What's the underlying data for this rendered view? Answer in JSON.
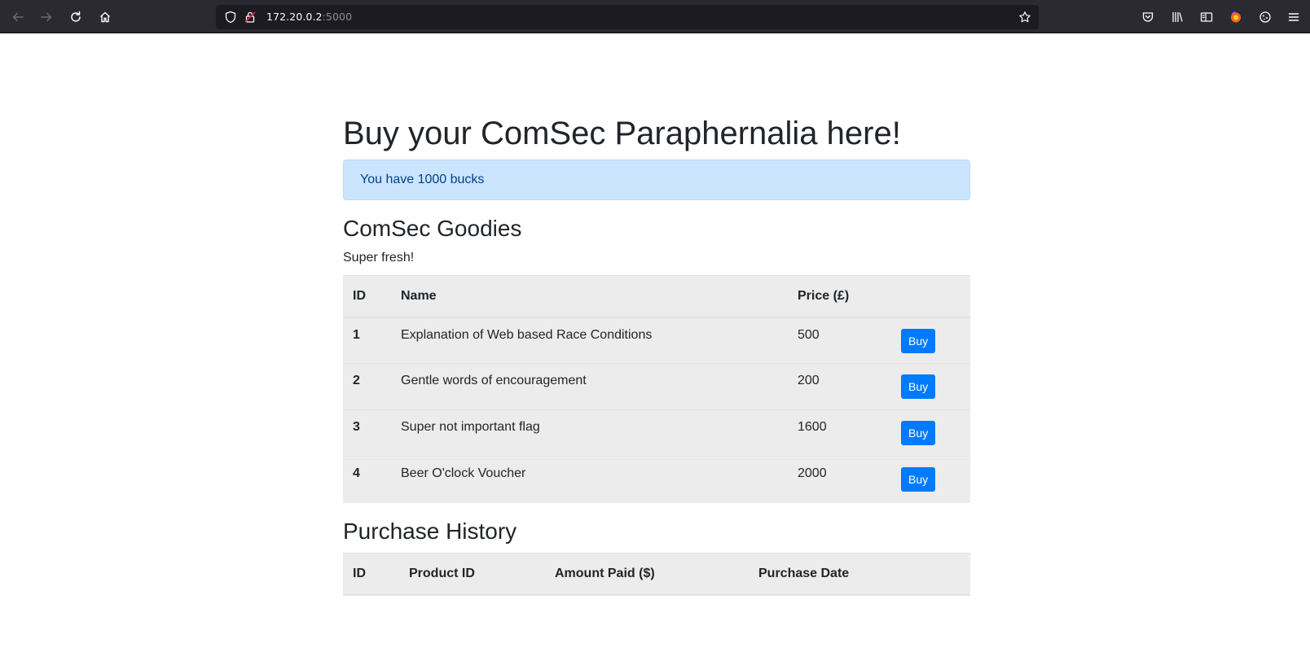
{
  "browser": {
    "url_host": "172.20.0.2",
    "url_port": ":5000"
  },
  "page": {
    "title": "Buy your ComSec Paraphernalia here!",
    "balance_alert": "You have 1000 bucks"
  },
  "goodies": {
    "title": "ComSec Goodies",
    "subtitle": "Super fresh!",
    "columns": [
      "ID",
      "Name",
      "Price (£)",
      ""
    ],
    "buy_label": "Buy",
    "rows": [
      {
        "id": "1",
        "name": "Explanation of Web based Race Conditions",
        "price": "500"
      },
      {
        "id": "2",
        "name": "Gentle words of encouragement",
        "price": "200"
      },
      {
        "id": "3",
        "name": "Super not important flag",
        "price": "1600"
      },
      {
        "id": "4",
        "name": "Beer O'clock Voucher",
        "price": "2000"
      }
    ]
  },
  "history": {
    "title": "Purchase History",
    "columns": [
      "ID",
      "Product ID",
      "Amount Paid ($)",
      "Purchase Date"
    ],
    "rows": []
  },
  "colors": {
    "alert_bg": "#cce5ff",
    "alert_text": "#004085",
    "button": "#007bff",
    "table_bg": "#ececec",
    "chrome_bg": "#2b2a33"
  },
  "icons": [
    "back-arrow-icon",
    "forward-arrow-icon",
    "reload-icon",
    "home-icon",
    "shield-icon",
    "insecure-lock-icon",
    "bookmark-star-icon",
    "pocket-icon",
    "library-icon",
    "sidebar-icon",
    "firefox-account-icon",
    "cookie-extension-icon",
    "menu-icon"
  ]
}
